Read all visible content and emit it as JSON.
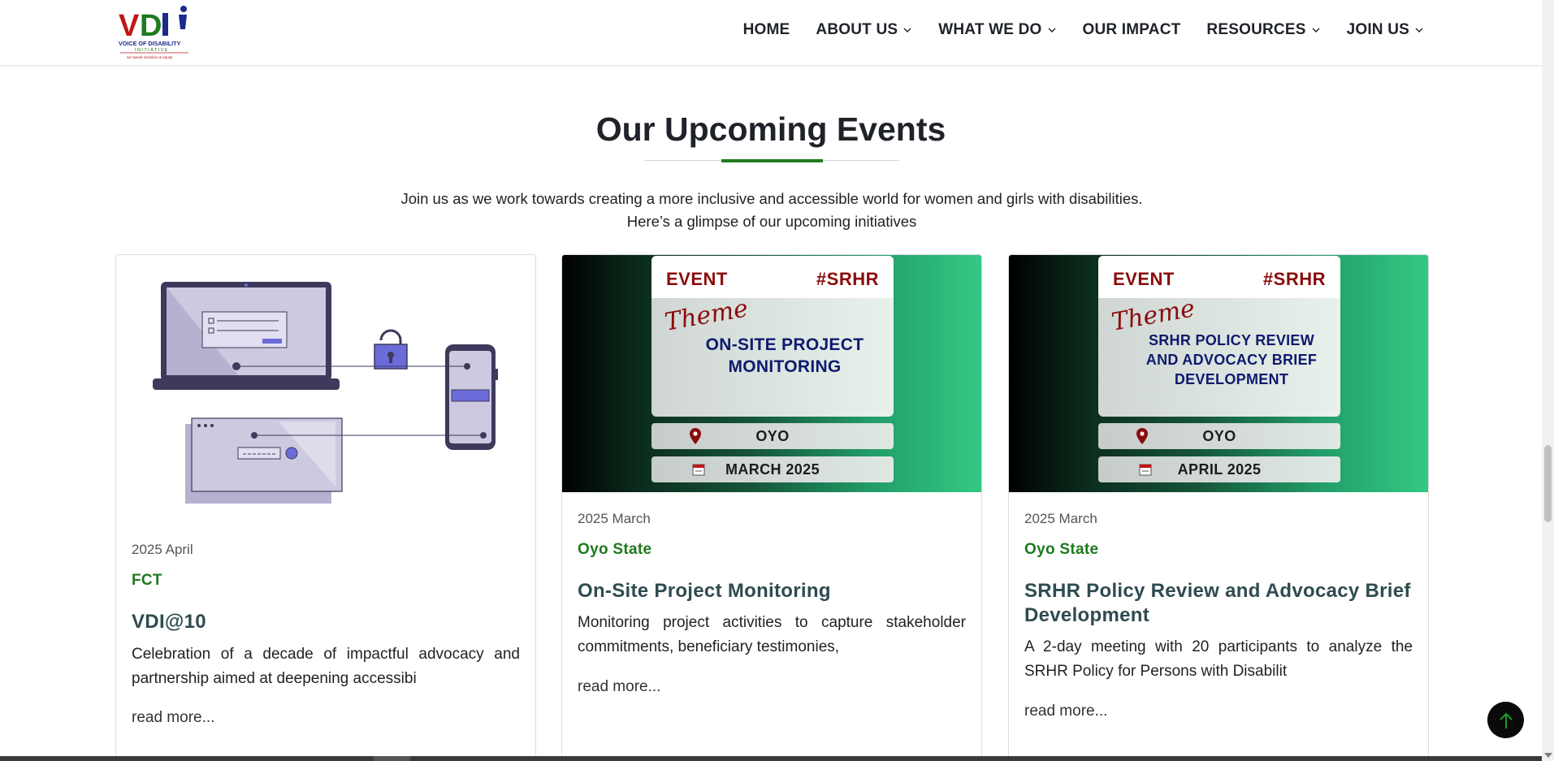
{
  "logo": {
    "letters": "VDI",
    "org_name": "VOICE OF DISABILITY",
    "org_sub": "INITIATIVE",
    "tagline": "we speak inclusion & equity",
    "colors": {
      "red": "#c0161a",
      "green": "#1e7a1e",
      "blue": "#1b2a8c"
    }
  },
  "nav": {
    "items": [
      {
        "label": "HOME",
        "has_dropdown": false
      },
      {
        "label": "ABOUT US",
        "has_dropdown": true
      },
      {
        "label": "WHAT WE DO",
        "has_dropdown": true
      },
      {
        "label": "OUR IMPACT",
        "has_dropdown": false
      },
      {
        "label": "RESOURCES",
        "has_dropdown": true
      },
      {
        "label": "JOIN US",
        "has_dropdown": true
      }
    ],
    "dropdown_icon": "chevron-down-icon"
  },
  "section": {
    "title": "Our Upcoming Events",
    "subtitle": "Join us as we work towards creating a more inclusive and accessible world for women and girls with disabilities. Here’s a glimpse of our upcoming initiatives",
    "accent_color": "#1e7a1e"
  },
  "cards": [
    {
      "date": "2025 April",
      "location": "FCT",
      "title": "VDI@10",
      "description": "Celebration of a decade of impactful advocacy and partnership aimed at deepening accessibi",
      "read_more": "read more..."
    },
    {
      "date": "2025 March",
      "location": "Oyo State",
      "title": "On-Site Project Monitoring",
      "description": "Monitoring project activities to capture stakeholder commitments, beneficiary testimonies,",
      "read_more": "read more...",
      "poster": {
        "label": "EVENT",
        "tag": "#SRHR",
        "theme_word": "Theme",
        "heading_lines": [
          "ON-SITE PROJECT",
          "MONITORING"
        ],
        "place": "OYO",
        "when": "MARCH 2025"
      }
    },
    {
      "date": "2025 March",
      "location": "Oyo State",
      "title": "SRHR Policy Review and Advocacy Brief Development",
      "description": "A 2-day meeting with 20 participants to analyze the SRHR Policy for Persons with Disabilit",
      "read_more": "read more...",
      "poster": {
        "label": "EVENT",
        "tag": "#SRHR",
        "theme_word": "Theme",
        "heading_lines": [
          "SRHR POLICY REVIEW",
          "AND ADVOCACY BRIEF",
          "DEVELOPMENT"
        ],
        "place": "OYO",
        "when": "APRIL 2025"
      }
    }
  ],
  "icons": {
    "back_to_top": "arrow-up-icon",
    "location": "map-pin-icon",
    "calendar": "calendar-icon"
  }
}
